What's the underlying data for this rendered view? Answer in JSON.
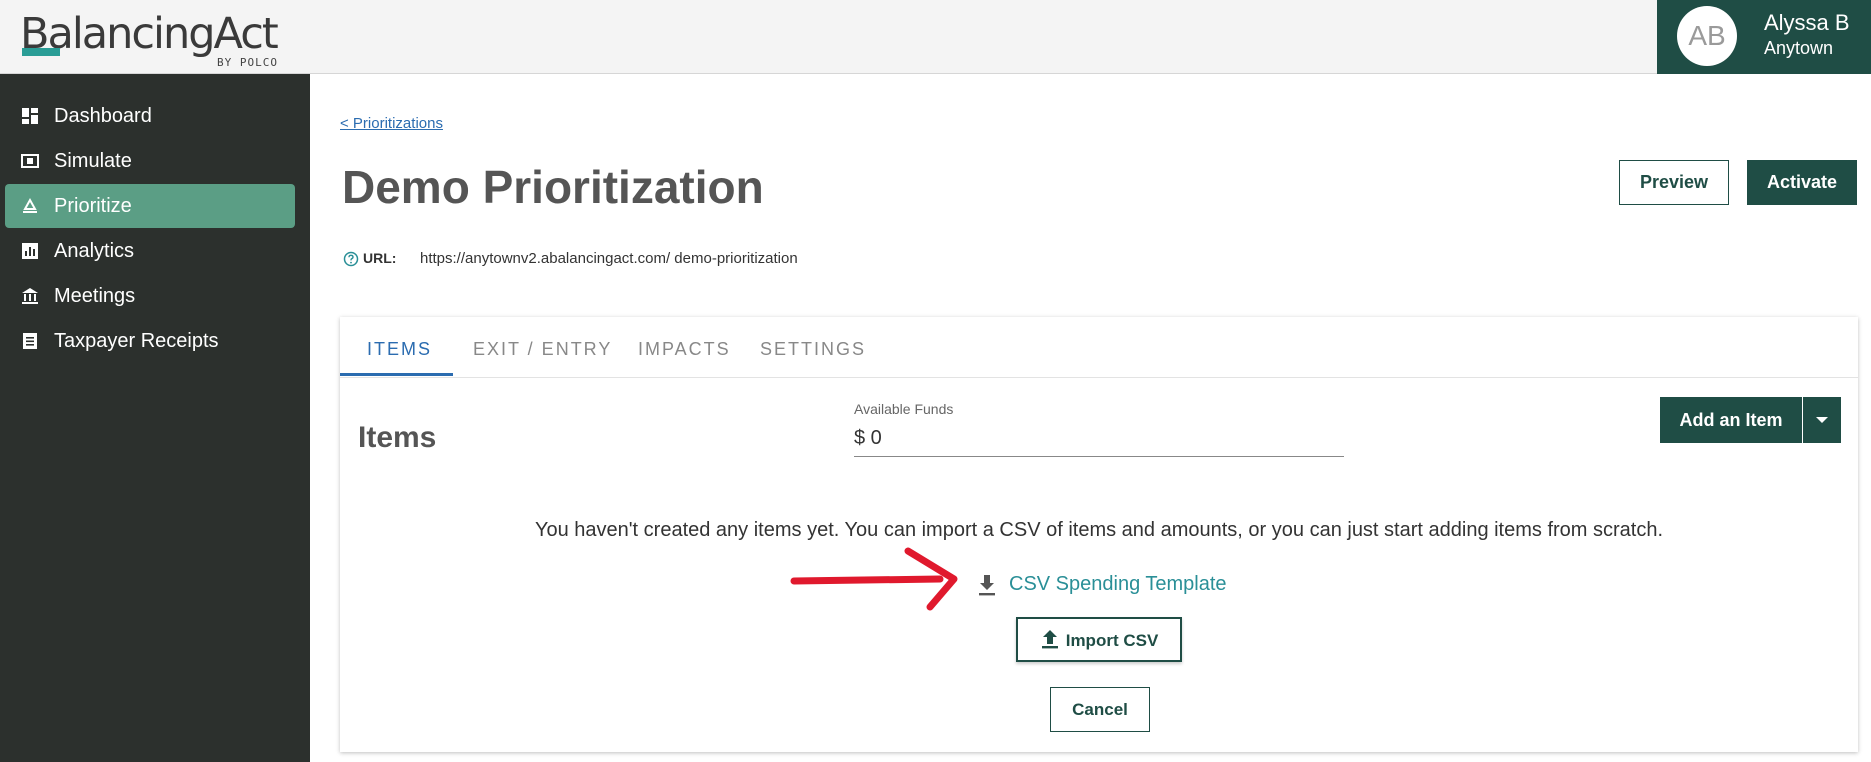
{
  "header": {
    "logo_text": "BalancingAct",
    "logo_sub": "BY POLCO",
    "user": {
      "initials": "AB",
      "name": "Alyssa B",
      "org": "Anytown"
    }
  },
  "sidebar": {
    "items": [
      {
        "label": "Dashboard",
        "icon": "dashboard-icon",
        "active": false
      },
      {
        "label": "Simulate",
        "icon": "simulate-icon",
        "active": false
      },
      {
        "label": "Prioritize",
        "icon": "prioritize-icon",
        "active": true
      },
      {
        "label": "Analytics",
        "icon": "analytics-icon",
        "active": false
      },
      {
        "label": "Meetings",
        "icon": "meetings-icon",
        "active": false
      },
      {
        "label": "Taxpayer Receipts",
        "icon": "receipts-icon",
        "active": false
      }
    ]
  },
  "main": {
    "breadcrumb": "< Prioritizations",
    "title": "Demo Prioritization",
    "preview_label": "Preview",
    "activate_label": "Activate",
    "url_label": "URL:",
    "url_value": "https://anytownv2.abalancingact.com/ demo-prioritization",
    "tabs": [
      {
        "label": "ITEMS",
        "active": true
      },
      {
        "label": "EXIT / ENTRY",
        "active": false
      },
      {
        "label": "IMPACTS",
        "active": false
      },
      {
        "label": "SETTINGS",
        "active": false
      }
    ],
    "items_section": {
      "title": "Items",
      "funds_label": "Available Funds",
      "funds_value": "$ 0",
      "add_label": "Add an Item",
      "empty_message": "You haven't created any items yet. You can import a CSV of items and amounts, or you can just start adding items from scratch.",
      "csv_template_label": "CSV Spending Template",
      "import_label": "Import CSV",
      "cancel_label": "Cancel"
    }
  },
  "colors": {
    "brand_dark": "#1f4d45",
    "sidebar_bg": "#2c302d",
    "sidebar_active": "#5b9e85",
    "link_blue": "#2b6cb0",
    "teal_link": "#2a8f97",
    "annotation_arrow": "#e0192d"
  }
}
